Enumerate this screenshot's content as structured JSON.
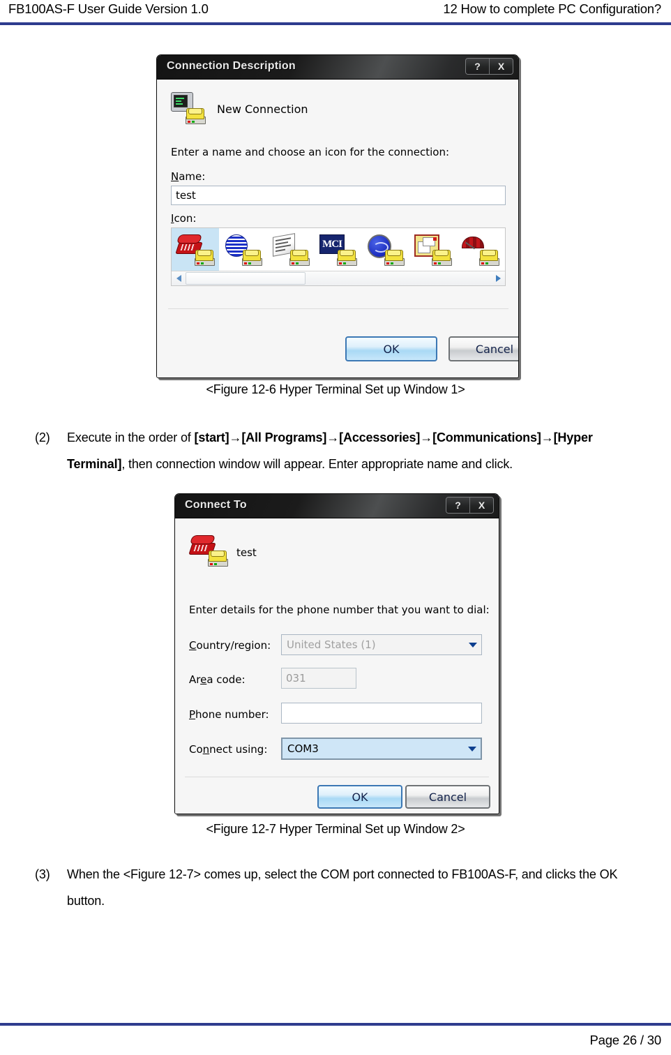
{
  "header": {
    "left": "FB100AS-F User Guide Version 1.0",
    "right": "12 How to complete PC Configuration?"
  },
  "footer": {
    "page": "Page 26 / 30"
  },
  "colors": {
    "rule": "#2e3c8e",
    "titlebar_dark": "#141414",
    "selected_icon_bg": "#c9e4f5",
    "focused_field_bg": "#cfe6f7",
    "default_button_border": "#3c78b4"
  },
  "figure1": {
    "caption": "<Figure 12-6 Hyper Terminal Set up Window 1>",
    "dialog": {
      "title": "Connection Description",
      "help_button": "?",
      "close_button": "X",
      "heading": "New Connection",
      "instruction": "Enter a name and choose an icon for the connection:",
      "name_label": "Name:",
      "name_value": "test",
      "icon_label": "Icon:",
      "icons": [
        {
          "name": "red-telephone-modem-icon",
          "selected": true
        },
        {
          "name": "blue-striped-globe-modem-icon",
          "selected": false
        },
        {
          "name": "fax-newspaper-modem-icon",
          "selected": false
        },
        {
          "name": "mci-logo-modem-icon",
          "selected": false
        },
        {
          "name": "ge-globe-modem-icon",
          "selected": false
        },
        {
          "name": "documents-modem-icon",
          "selected": false
        },
        {
          "name": "umbrella-modem-icon",
          "selected": false
        }
      ],
      "ok_label": "OK",
      "cancel_label": "Cancel"
    }
  },
  "para2": {
    "marker": "(2)",
    "line1_a": "Execute in the order of ",
    "line1_b1": "[start]",
    "arrow": "→",
    "line1_b2": "[All Programs]",
    "line1_b3": "[Accessories]",
    "line1_b4": "[Communications]",
    "line1_b5": "[Hyper",
    "line2_b": "Terminal]",
    "line2_a": ", then connection window will appear. Enter appropriate name and click."
  },
  "figure2": {
    "caption": "<Figure 12-7 Hyper Terminal Set up Window 2>",
    "dialog": {
      "title": "Connect To",
      "help_button": "?",
      "close_button": "X",
      "heading": "test",
      "instruction": "Enter details for the phone number that you want to dial:",
      "fields": [
        {
          "label": "Country/region:",
          "value": "United States (1)",
          "type": "combo",
          "state": "disabled"
        },
        {
          "label": "Area code:",
          "value": "031",
          "type": "text",
          "state": "disabled"
        },
        {
          "label": "Phone number:",
          "value": "",
          "type": "text",
          "state": "normal"
        },
        {
          "label": "Connect using:",
          "value": "COM3",
          "type": "combo",
          "state": "focused"
        }
      ],
      "ok_label": "OK",
      "cancel_label": "Cancel"
    }
  },
  "para3": {
    "marker": "(3)",
    "line1": "When the <Figure 12-7> comes up, select the COM port connected to FB100AS-F, and clicks the OK",
    "line2": "button."
  }
}
